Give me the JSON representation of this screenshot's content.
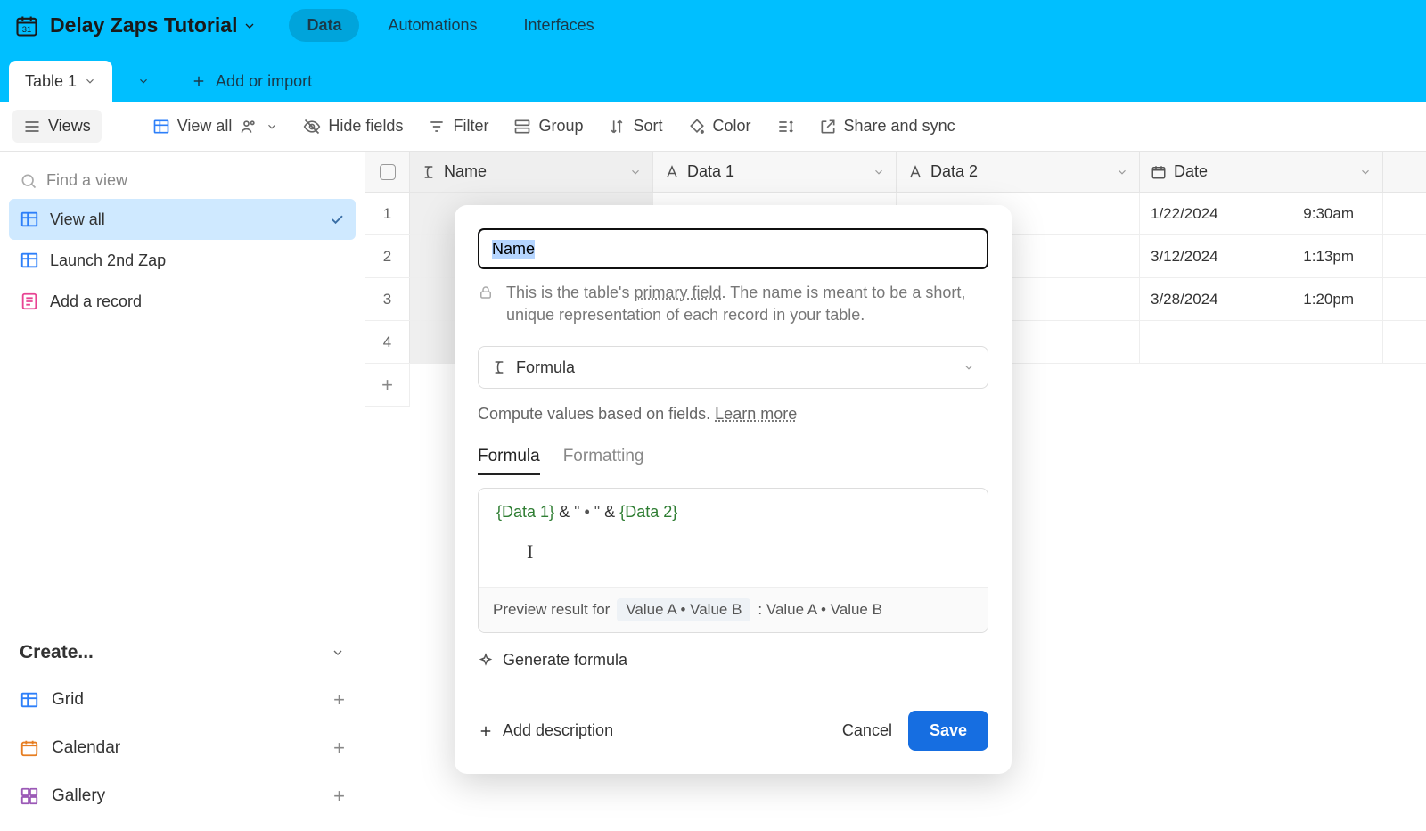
{
  "header": {
    "base_name": "Delay Zaps Tutorial",
    "nav": {
      "data": "Data",
      "automations": "Automations",
      "interfaces": "Interfaces"
    }
  },
  "tabs": {
    "current": "Table 1",
    "add_import": "Add or import"
  },
  "toolbar": {
    "views": "Views",
    "view_all": "View all",
    "hide_fields": "Hide fields",
    "filter": "Filter",
    "group": "Group",
    "sort": "Sort",
    "color": "Color",
    "share": "Share and sync"
  },
  "sidebar": {
    "search_placeholder": "Find a view",
    "views": [
      {
        "label": "View all",
        "active": true
      },
      {
        "label": "Launch 2nd Zap",
        "active": false
      }
    ],
    "add_record": "Add a record",
    "create_header": "Create...",
    "create_items": {
      "grid": "Grid",
      "calendar": "Calendar",
      "gallery": "Gallery"
    }
  },
  "grid": {
    "columns": {
      "name": "Name",
      "data1": "Data 1",
      "data2": "Data 2",
      "date": "Date"
    },
    "rows": [
      {
        "n": "1",
        "date": "1/22/2024",
        "time": "9:30am"
      },
      {
        "n": "2",
        "date": "3/12/2024",
        "time": "1:13pm"
      },
      {
        "n": "3",
        "date": "3/28/2024",
        "time": "1:20pm"
      },
      {
        "n": "4",
        "date": "",
        "time": ""
      }
    ]
  },
  "popover": {
    "field_name": "Name",
    "primary_note_a": "This is the table's ",
    "primary_note_link": "primary field",
    "primary_note_b": ". The name is meant to be a short, unique representation of each record in your table.",
    "type_label": "Formula",
    "compute_note": "Compute values based on fields. ",
    "learn_more": "Learn more",
    "tabs": {
      "formula": "Formula",
      "formatting": "Formatting"
    },
    "formula": {
      "f1": "{Data 1}",
      "amp1": " & ",
      "str": "\" • \"",
      "amp2": " & ",
      "f2": "{Data 2}"
    },
    "preview_label": "Preview result for",
    "preview_chip": "Value A • Value B",
    "preview_result": ": Value A • Value B",
    "generate": "Generate formula",
    "add_description": "Add description",
    "cancel": "Cancel",
    "save": "Save"
  }
}
